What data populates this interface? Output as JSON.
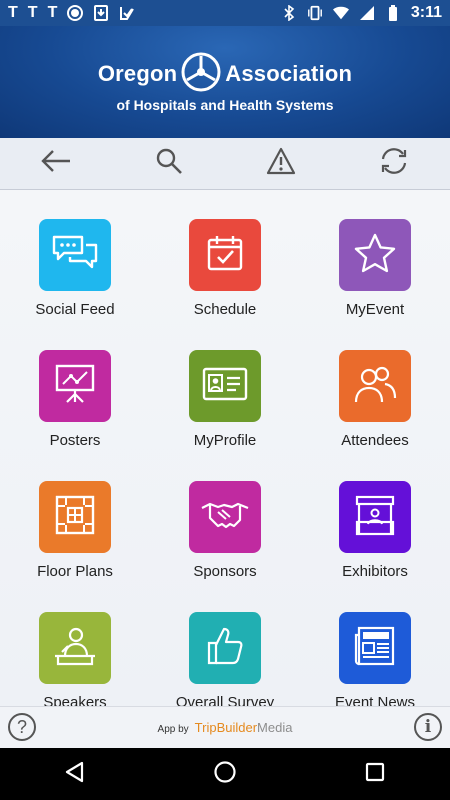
{
  "status_bar": {
    "left_glyphs": [
      "T",
      "T",
      "T"
    ],
    "left_icons": [
      "record-icon",
      "download-icon",
      "check-icon"
    ],
    "right_icons": [
      "bluetooth-icon",
      "vibrate-icon",
      "wifi-icon",
      "signal-icon",
      "battery-icon"
    ],
    "time": "3:11"
  },
  "header": {
    "logo_word_left": "Oregon",
    "logo_word_right": "Association",
    "logo_subtitle": "of Hospitals and Health Systems"
  },
  "toolbar": {
    "buttons": [
      "back-arrow-icon",
      "search-icon",
      "alert-icon",
      "refresh-icon"
    ]
  },
  "tiles": [
    {
      "label": "Social Feed",
      "color": "#1fb7ee",
      "icon": "chat-bubbles-icon"
    },
    {
      "label": "Schedule",
      "color": "#e9493d",
      "icon": "calendar-check-icon"
    },
    {
      "label": "MyEvent",
      "color": "#8e57b9",
      "icon": "star-icon"
    },
    {
      "label": "Posters",
      "color": "#c02aa0",
      "icon": "presentation-board-icon"
    },
    {
      "label": "MyProfile",
      "color": "#6d9a2b",
      "icon": "id-card-icon"
    },
    {
      "label": "Attendees",
      "color": "#ea6b2c",
      "icon": "people-icon"
    },
    {
      "label": "Floor Plans",
      "color": "#ea7a2a",
      "icon": "floor-plan-icon"
    },
    {
      "label": "Sponsors",
      "color": "#c02aa0",
      "icon": "handshake-icon"
    },
    {
      "label": "Exhibitors",
      "color": "#6410d8",
      "icon": "booth-icon"
    },
    {
      "label": "Speakers",
      "color": "#98b63b",
      "icon": "speaker-podium-icon"
    },
    {
      "label": "Overall Survey",
      "color": "#21afb2",
      "icon": "thumbs-up-icon"
    },
    {
      "label": "Event News",
      "color": "#1e5bd8",
      "icon": "newspaper-icon"
    }
  ],
  "footer": {
    "help_glyph": "?",
    "info_glyph": "i",
    "app_by": "App by",
    "brand_part1": "TripBuilder",
    "brand_part2": "Media"
  },
  "nav": {
    "buttons": [
      "back-triangle-icon",
      "home-circle-icon",
      "recents-square-icon"
    ]
  }
}
